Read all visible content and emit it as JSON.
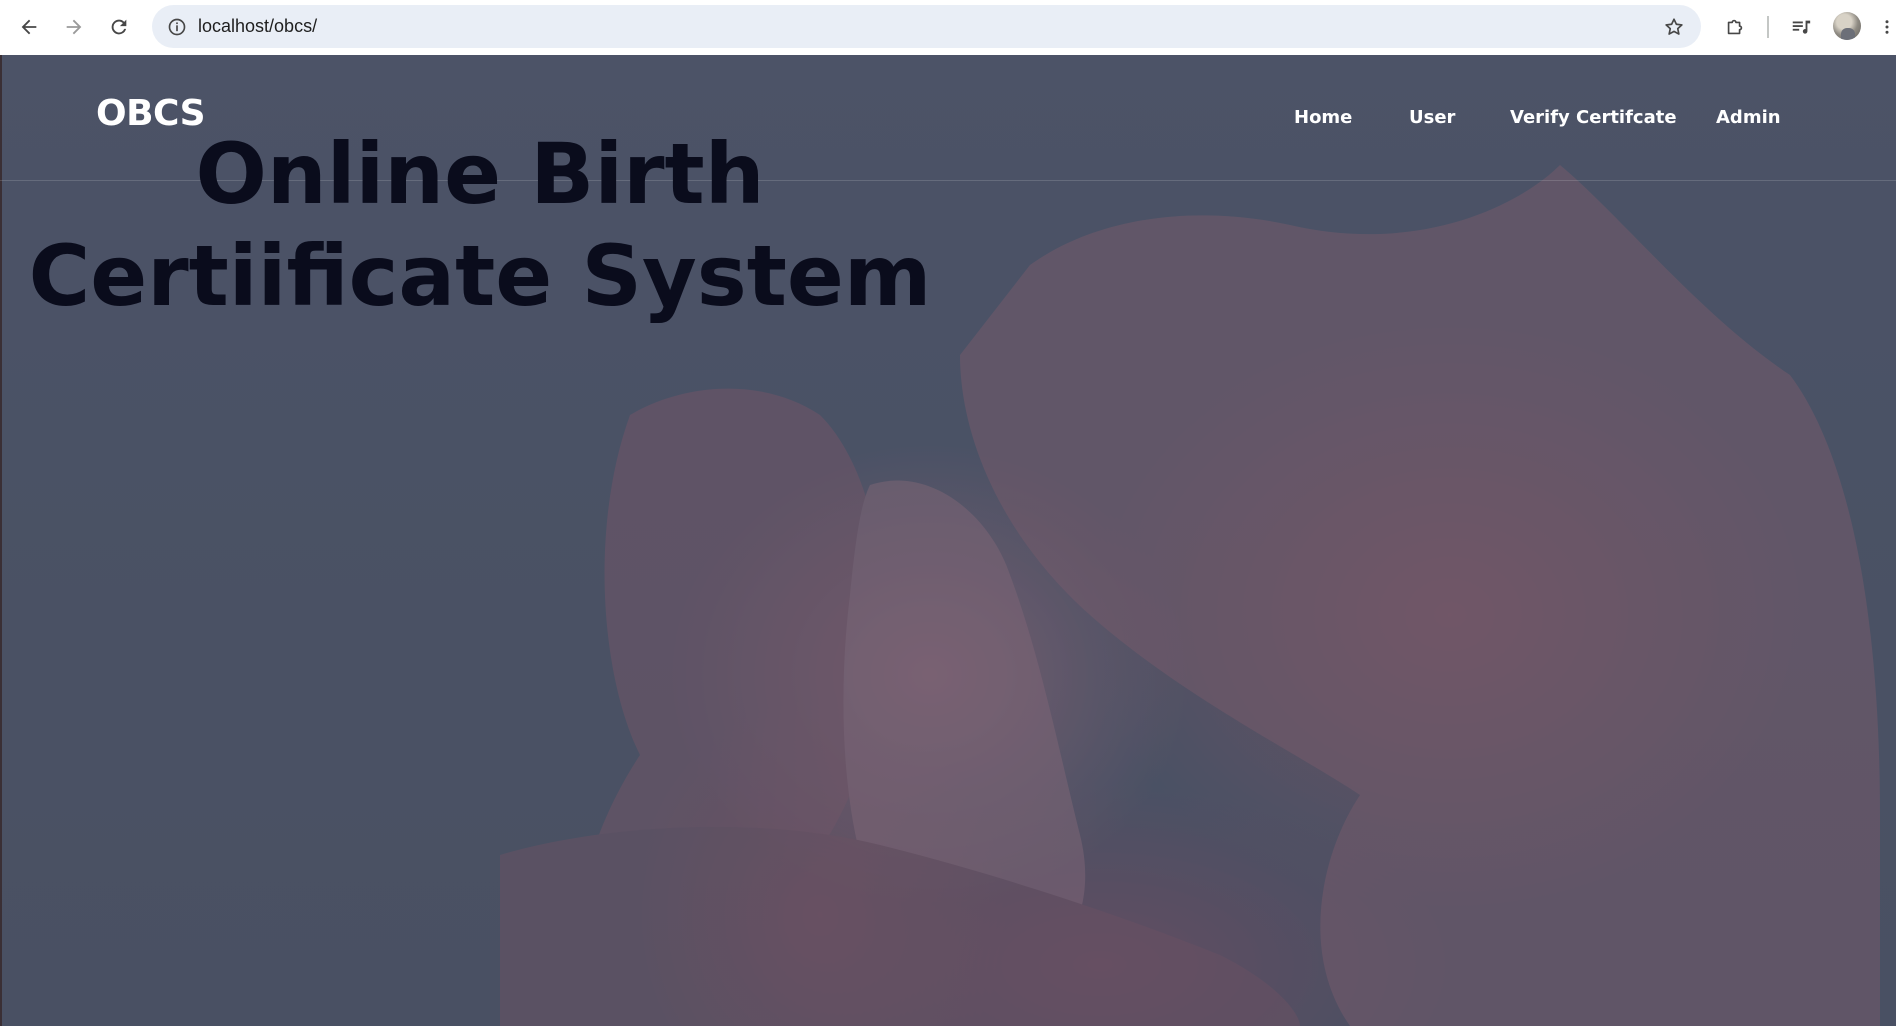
{
  "browser": {
    "url": "localhost/obcs/",
    "icons": {
      "back": "back-arrow-icon",
      "forward": "forward-arrow-icon",
      "reload": "reload-icon",
      "site_info": "info-icon",
      "bookmark": "star-icon",
      "extensions": "puzzle-icon",
      "media": "media-queue-icon",
      "profile": "avatar",
      "menu": "kebab-menu-icon"
    }
  },
  "site": {
    "logo": "OBCS",
    "nav": [
      {
        "label": "Home"
      },
      {
        "label": "User"
      },
      {
        "label": "Verify Certifcate"
      },
      {
        "label": "Admin"
      }
    ]
  },
  "hero": {
    "title": "Online Birth Certiificate System"
  },
  "colors": {
    "overlay": "#202840",
    "title": "#0a0c1c",
    "nav_text": "#ffffff",
    "omnibox_bg": "#e9eef6"
  }
}
